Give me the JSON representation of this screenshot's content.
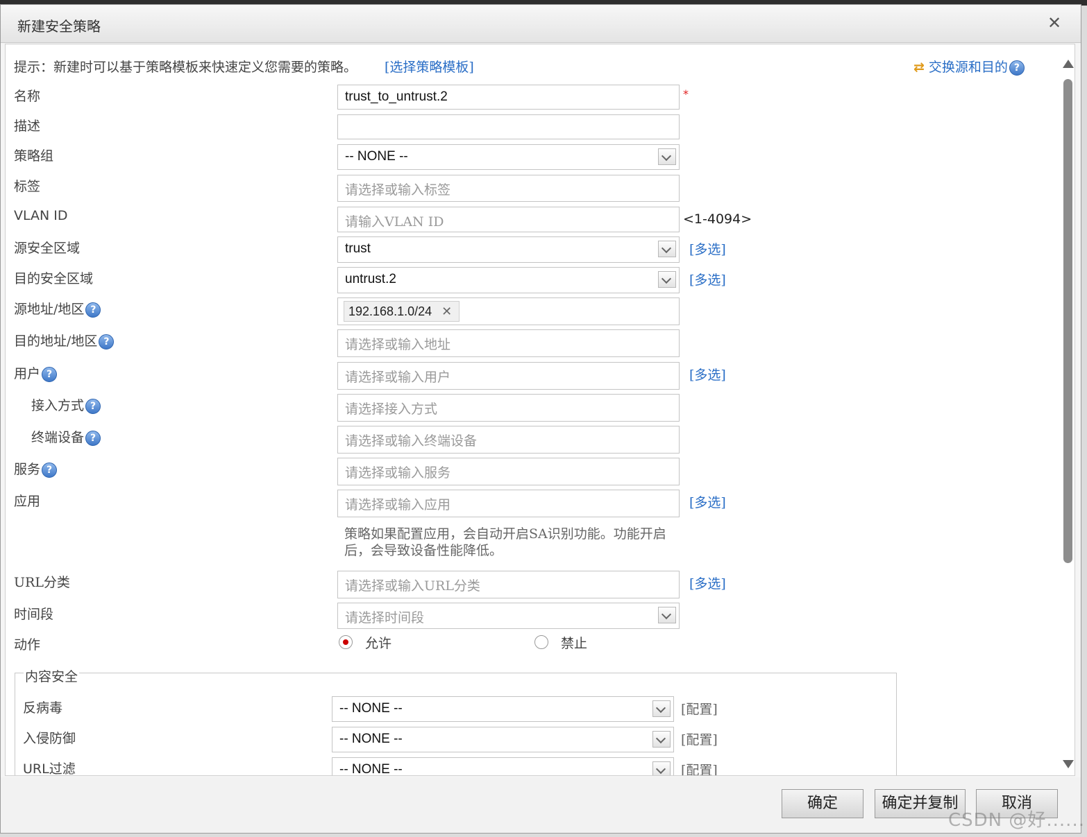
{
  "dialog": {
    "title": "新建安全策略",
    "close": "✕"
  },
  "hint": {
    "text": "提示：新建时可以基于策略模板来快速定义您需要的策略。",
    "template_link": "[选择策略模板]",
    "swap_link": "交换源和目的"
  },
  "form": {
    "name": {
      "label": "名称",
      "value": "trust_to_untrust.2",
      "required": "*"
    },
    "desc": {
      "label": "描述",
      "value": ""
    },
    "group": {
      "label": "策略组",
      "value": "-- NONE --"
    },
    "tag": {
      "label": "标签",
      "placeholder": "请选择或输入标签"
    },
    "vlan": {
      "label": "VLAN ID",
      "placeholder": "请输入VLAN ID",
      "range": "<1-4094>"
    },
    "src_zone": {
      "label": "源安全区域",
      "value": "trust",
      "multi": "[多选]"
    },
    "dst_zone": {
      "label": "目的安全区域",
      "value": "untrust.2",
      "multi": "[多选]"
    },
    "src_addr": {
      "label": "源地址/地区",
      "tag": "192.168.1.0/24",
      "remove": "✕"
    },
    "dst_addr": {
      "label": "目的地址/地区",
      "placeholder": "请选择或输入地址"
    },
    "user": {
      "label": "用户",
      "placeholder": "请选择或输入用户",
      "multi": "[多选]"
    },
    "access": {
      "label": "接入方式",
      "placeholder": "请选择接入方式"
    },
    "terminal": {
      "label": "终端设备",
      "placeholder": "请选择或输入终端设备"
    },
    "service": {
      "label": "服务",
      "placeholder": "请选择或输入服务"
    },
    "app": {
      "label": "应用",
      "placeholder": "请选择或输入应用",
      "multi": "[多选]",
      "note": "策略如果配置应用，会自动开启SA识别功能。功能开启后，会导致设备性能降低。"
    },
    "url_cat": {
      "label": "URL分类",
      "placeholder": "请选择或输入URL分类",
      "multi": "[多选]"
    },
    "time": {
      "label": "时间段",
      "placeholder": "请选择时间段"
    },
    "action": {
      "label": "动作",
      "permit": "允许",
      "deny": "禁止",
      "selected": "permit"
    }
  },
  "content_security": {
    "legend": "内容安全",
    "rows": [
      {
        "label": "反病毒",
        "value": "-- NONE --",
        "config": "[配置]"
      },
      {
        "label": "入侵防御",
        "value": "-- NONE --",
        "config": "[配置]"
      },
      {
        "label": "URL过滤",
        "value": "-- NONE --",
        "config": "[配置]"
      }
    ]
  },
  "help_icon": "?",
  "buttons": {
    "ok": "确定",
    "ok_copy": "确定并复制",
    "cancel": "取消"
  },
  "watermark": "CSDN @好......"
}
